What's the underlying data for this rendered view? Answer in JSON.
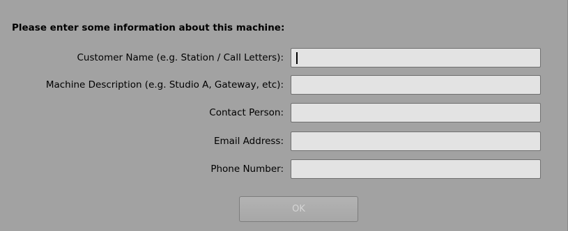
{
  "form": {
    "heading": "Please enter some information about this machine:",
    "fields": [
      {
        "label": "Customer Name (e.g. Station / Call Letters):",
        "value": "",
        "placeholder": ""
      },
      {
        "label": "Machine Description (e.g. Studio A, Gateway, etc):",
        "value": "",
        "placeholder": ""
      },
      {
        "label": "Contact Person:",
        "value": "",
        "placeholder": ""
      },
      {
        "label": "Email Address:",
        "value": "",
        "placeholder": ""
      },
      {
        "label": "Phone Number:",
        "value": "",
        "placeholder": ""
      }
    ],
    "ok_label": "OK",
    "ok_disabled": true
  }
}
